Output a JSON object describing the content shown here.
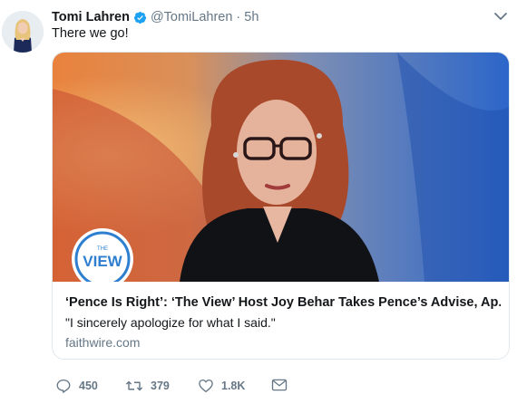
{
  "tweet": {
    "display_name": "Tomi Lahren",
    "handle": "@TomiLahren",
    "separator": "·",
    "time": "5h",
    "text": "There we go!"
  },
  "card": {
    "title": "‘Pence Is Right’: ‘The View’ Host Joy Behar Takes Pence’s Advise, Ap...",
    "description": "\"I sincerely apologize for what I said.\"",
    "domain": "faithwire.com",
    "logo_small": "THE",
    "logo_text": "VIEW"
  },
  "actions": {
    "replies": "450",
    "retweets": "379",
    "likes": "1.8K"
  },
  "colors": {
    "verified": "#1da1f2",
    "muted": "#657786",
    "text": "#14171a",
    "border": "#e1e8ed"
  },
  "icons": [
    "verified-badge-icon",
    "chevron-down-icon",
    "reply-icon",
    "retweet-icon",
    "like-icon",
    "direct-message-icon"
  ]
}
